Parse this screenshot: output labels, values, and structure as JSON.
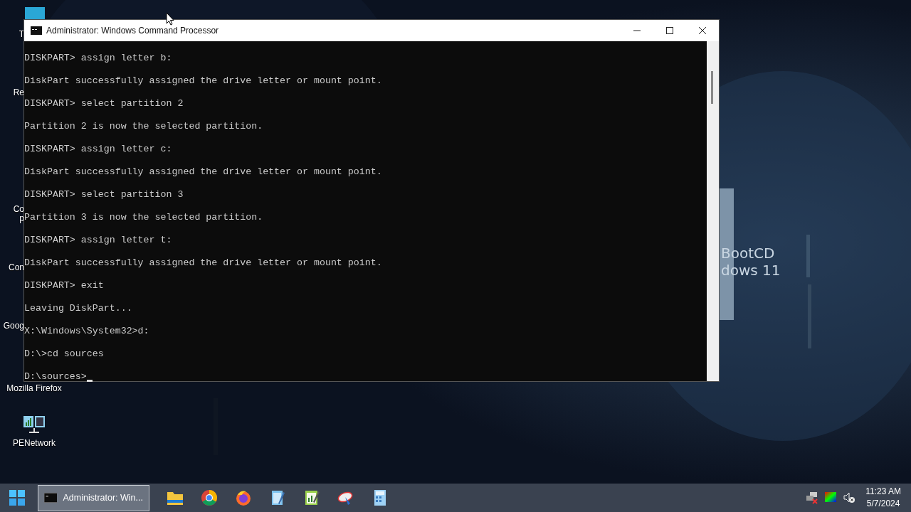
{
  "desktop": {
    "icons": [
      {
        "label_lines": [
          "T"
        ],
        "kind": "hidden"
      },
      {
        "label_lines": [
          "Re"
        ],
        "kind": "hidden"
      },
      {
        "label_lines": [
          "Co",
          "p"
        ],
        "kind": "hidden"
      },
      {
        "label_lines": [
          "Con"
        ],
        "kind": "hidden"
      },
      {
        "label_lines": [
          "Goog"
        ],
        "kind": "hidden"
      },
      {
        "label_lines": [
          "Mozilla Firefox"
        ],
        "kind": "hidden"
      },
      {
        "label_lines": [
          "PENetwork"
        ],
        "kind": "network"
      }
    ],
    "wallpaper_text": [
      "BootCD",
      "dows 11"
    ]
  },
  "window": {
    "title": "Administrator: Windows Command Processor",
    "console_lines": [
      "DISKPART> assign letter b:",
      "DiskPart successfully assigned the drive letter or mount point.",
      "DISKPART> select partition 2",
      "Partition 2 is now the selected partition.",
      "DISKPART> assign letter c:",
      "DiskPart successfully assigned the drive letter or mount point.",
      "DISKPART> select partition 3",
      "Partition 3 is now the selected partition.",
      "DISKPART> assign letter t:",
      "DiskPart successfully assigned the drive letter or mount point.",
      "DISKPART> exit",
      "Leaving DiskPart...",
      "X:\\Windows\\System32>d:",
      "D:\\>cd sources",
      "D:\\sources>"
    ]
  },
  "taskbar": {
    "tasks": [
      {
        "label": "Administrator: Win...",
        "selected": true
      }
    ],
    "pinned": [
      {
        "kind": "folder"
      },
      {
        "kind": "chrome"
      },
      {
        "kind": "firefox"
      },
      {
        "kind": "notepad"
      },
      {
        "kind": "chart"
      },
      {
        "kind": "dish"
      },
      {
        "kind": "calc"
      }
    ],
    "tray": [
      {
        "kind": "network"
      },
      {
        "kind": "color"
      },
      {
        "kind": "sound"
      }
    ],
    "time": "11:23 AM",
    "date": "5/7/2024"
  }
}
